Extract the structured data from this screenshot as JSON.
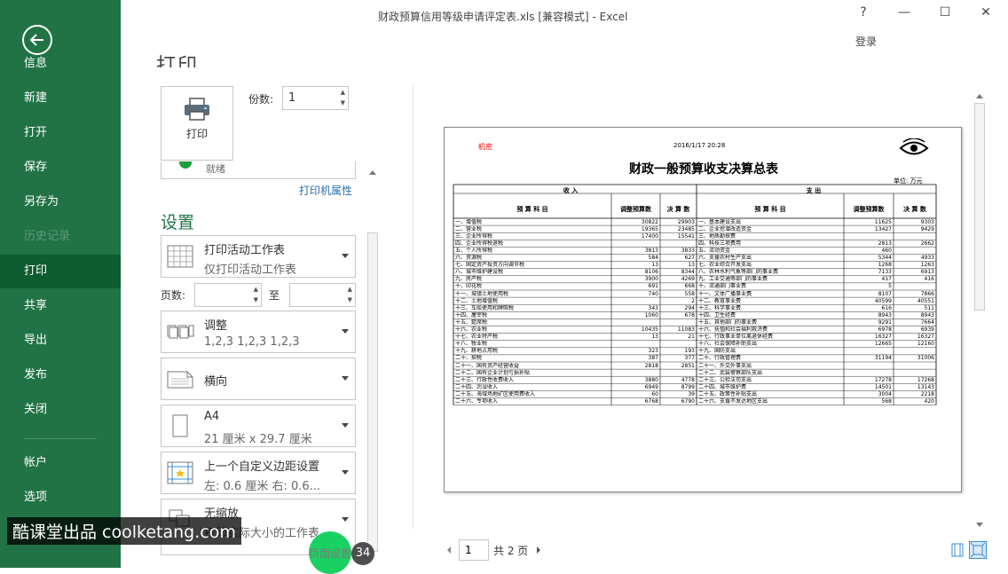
{
  "window": {
    "title": "财政预算信用等级申请评定表.xls  [兼容模式] - Excel",
    "help": "?",
    "minimize": "—",
    "restore": "☐",
    "close": "✕",
    "login": "登录"
  },
  "sidebar": {
    "items": [
      {
        "label": "信息"
      },
      {
        "label": "新建"
      },
      {
        "label": "打开"
      },
      {
        "label": "保存"
      },
      {
        "label": "另存为"
      },
      {
        "label": "历史记录"
      },
      {
        "label": "打印"
      },
      {
        "label": "共享"
      },
      {
        "label": "导出"
      },
      {
        "label": "发布"
      },
      {
        "label": "关闭"
      },
      {
        "label": "帐户"
      },
      {
        "label": "选项"
      }
    ]
  },
  "print": {
    "heading": "打印",
    "button_label": "打印",
    "copies_label": "份数:",
    "copies_value": "1",
    "printer_status": "就绪",
    "printer_properties": "打印机属性",
    "settings_title": "设置",
    "pages_label": "页数:",
    "to_label": "至"
  },
  "options": {
    "what": {
      "title": "打印活动工作表",
      "sub": "仅打印活动工作表"
    },
    "collate": {
      "title": "调整",
      "sub": "1,2,3    1,2,3    1,2,3"
    },
    "orientation": {
      "title": "横向"
    },
    "paper": {
      "title": "A4",
      "sub": "21 厘米 x 29.7 厘米"
    },
    "margins": {
      "title": "上一个自定义边距设置",
      "sub": "左: 0.6 厘米    右: 0.6..."
    },
    "scaling": {
      "title": "无缩放",
      "sub": "打印实际大小的工作表"
    }
  },
  "pager": {
    "current": "1",
    "total": "共 2 页"
  },
  "overlay": {
    "watermark": "酷课堂出品 coolketang.com",
    "badge_text": "页面设置",
    "badge_num": "34"
  },
  "sheet": {
    "secret": "机密",
    "datetime": "2016/1/17 20:28",
    "title": "财政一般预算收支决算总表",
    "unit": "单位: 万元",
    "income_head": "收                    入",
    "expense_head": "支                    出",
    "col_item": "预     算     科     目",
    "col_adj": "调整预算数",
    "col_final": "决 算 数",
    "rows": [
      [
        "一、增值税",
        "30822",
        "29903",
        "一、基本建设支出",
        "11625",
        "9303"
      ],
      [
        "二、营业税",
        "19365",
        "23485",
        "二、企业挖潜改造资金",
        "13427",
        "9429"
      ],
      [
        "三、企业所得税",
        "17400",
        "15541",
        "三、地质勘探费",
        "",
        ""
      ],
      [
        "四、企业所得税退税",
        "",
        "",
        "四、科技三项费用",
        "2813",
        "2662"
      ],
      [
        "五、个人所得税",
        "3813",
        "3833",
        "五、流动资金",
        "460",
        ""
      ],
      [
        "六、资源税",
        "584",
        "627",
        "六、支援农村生产支出",
        "5344",
        "4933"
      ],
      [
        "七、固定资产投资方向调节税",
        "13",
        "13",
        "七、农业综合开发支出",
        "1268",
        "1263"
      ],
      [
        "八、城市维护建设税",
        "8106",
        "8344",
        "八、农林水利气象等部门的事业费",
        "7133",
        "6913"
      ],
      [
        "九、房产税",
        "3900",
        "4269",
        "九、工业交通等部门的事业费",
        "417",
        "416"
      ],
      [
        "十、印花税",
        "691",
        "668",
        "十、流通部门事业费",
        "5",
        ""
      ],
      [
        "十一、城镇土地使用税",
        "740",
        "558",
        "十一、文体广播事业费",
        "8107",
        "7866"
      ],
      [
        "十二、土地增值税",
        "",
        "2",
        "十二、教育事业费",
        "40599",
        "40551"
      ],
      [
        "十三、车船使用和牌照税",
        "343",
        "294",
        "十三、科学事业费",
        "616",
        "511"
      ],
      [
        "十四、屠宰税",
        "1060",
        "678",
        "十四、卫生经费",
        "8943",
        "8943"
      ],
      [
        "十五、筵席税",
        "",
        "",
        "十五、其他部门的事业费",
        "9291",
        "7664"
      ],
      [
        "十六、农业税",
        "10435",
        "11083",
        "十六、抚恤和社会福利救济费",
        "6978",
        "6939"
      ],
      [
        "十七、农业特产税",
        "13",
        "21",
        "十七、行政事业单位离退休经费",
        "16327",
        "16327"
      ],
      [
        "十八、牧业税",
        "",
        "",
        "十八、社会保障补助支出",
        "12665",
        "12160"
      ],
      [
        "十九、耕地占用税",
        "323",
        "193",
        "十九、国防支出",
        "",
        ""
      ],
      [
        "二十、契税",
        "387",
        "377",
        "二十、行政管理费",
        "31194",
        "31006"
      ],
      [
        "二十一、国有资产经营收益",
        "2818",
        "2851",
        "二十一、外交外事支出",
        "",
        ""
      ],
      [
        "二十二、国有企业计划亏损补贴",
        "",
        "",
        "二十二、武装警察部队支出",
        "",
        ""
      ],
      [
        "二十三、行政性收费收入",
        "3880",
        "4778",
        "二十三、公检法司支出",
        "17278",
        "17268"
      ],
      [
        "二十四、罚没收入",
        "6949",
        "8799",
        "二十四、城市维护费",
        "14501",
        "13143"
      ],
      [
        "二十五、海域场地矿区使用费收入",
        "60",
        "39",
        "二十五、政策性补贴支出",
        "3004",
        "2218"
      ],
      [
        "二十六、专项收入",
        "6768",
        "6790",
        "二十六、支援不发达地区支出",
        "568",
        "420"
      ]
    ]
  }
}
